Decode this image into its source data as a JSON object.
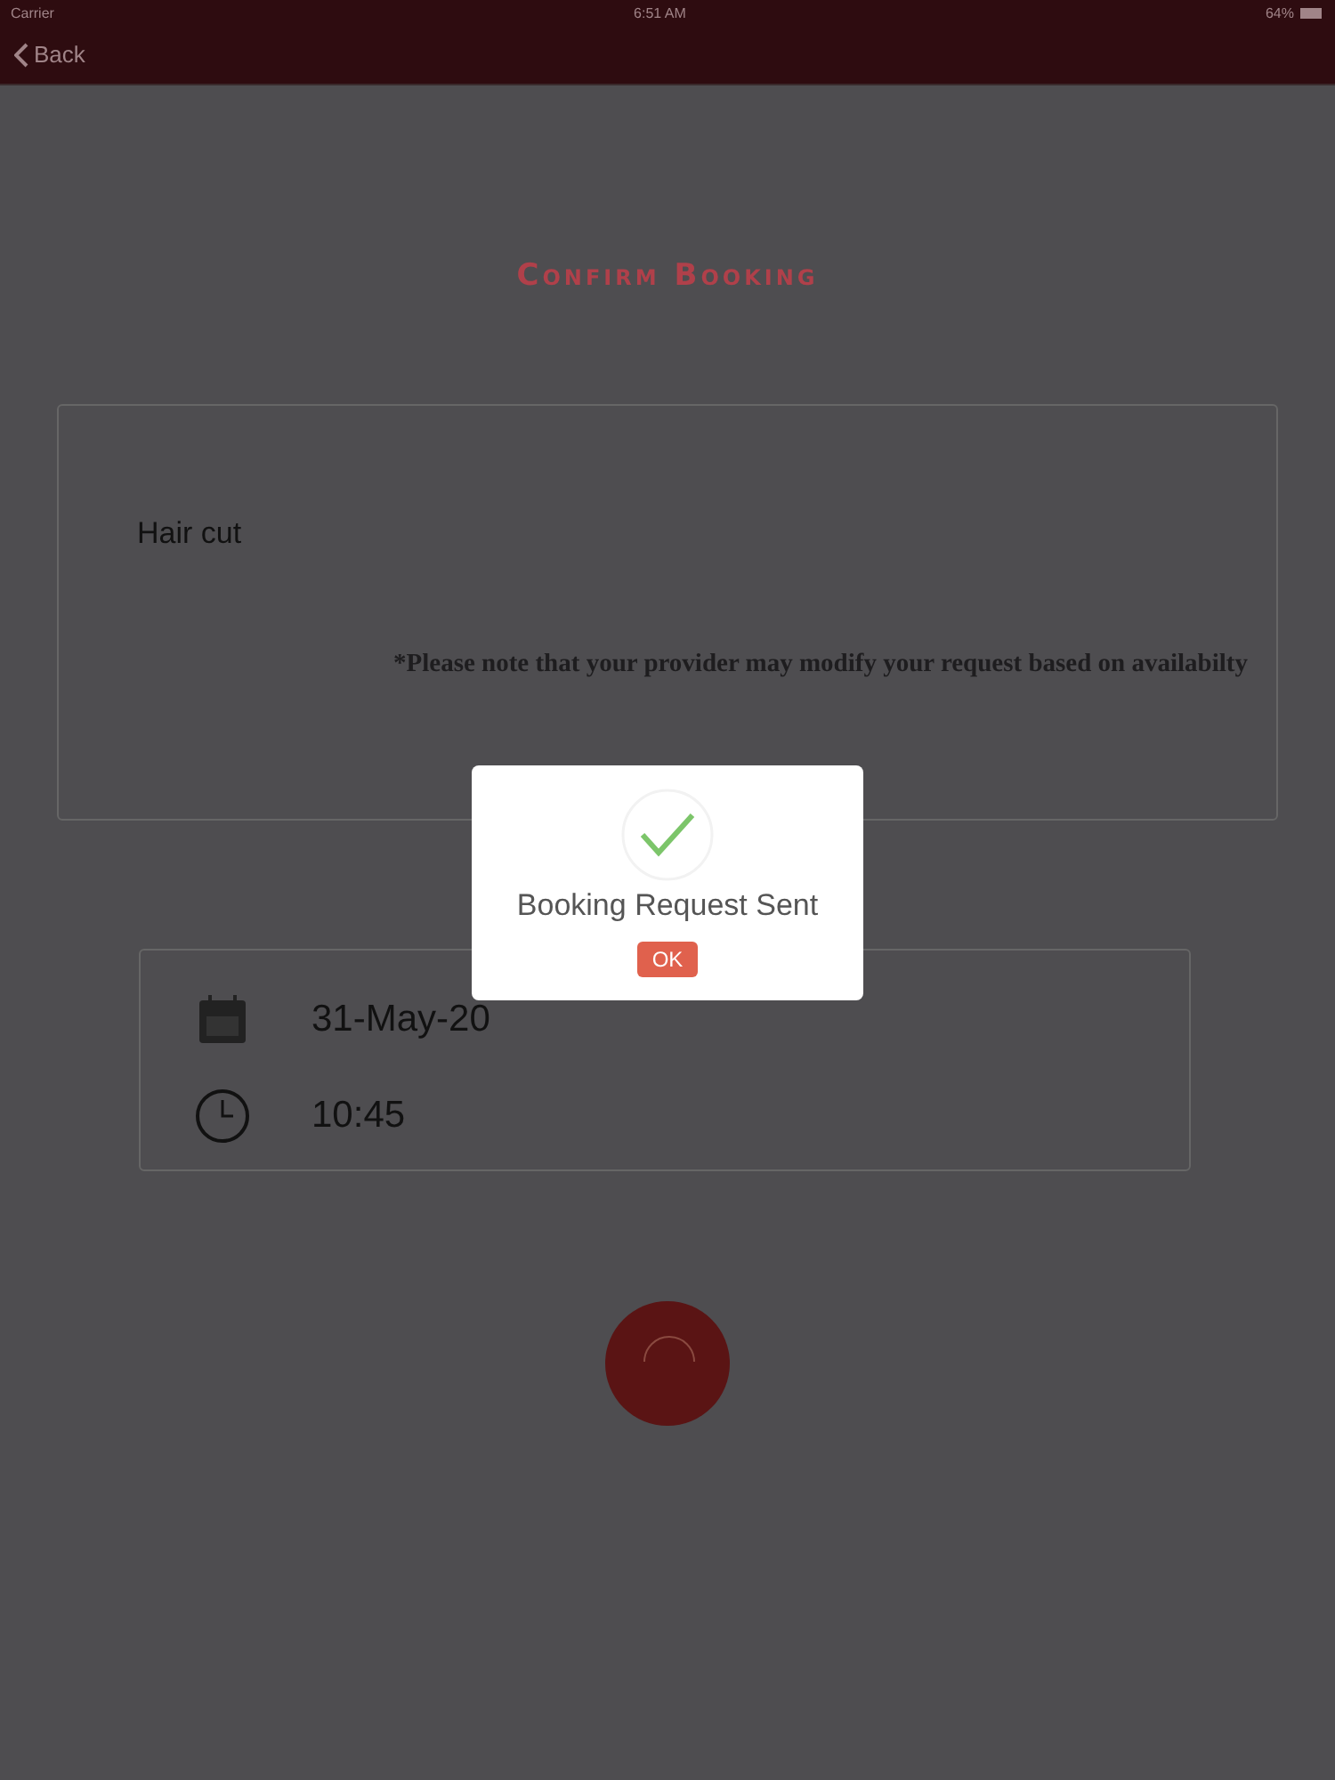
{
  "status_bar": {
    "carrier": "Carrier",
    "time": "6:51 AM",
    "battery": "64%"
  },
  "nav": {
    "back": "Back"
  },
  "title": "Confirm Booking",
  "service": {
    "name": "Hair cut",
    "note": "*Please note that your provider may modify your request based on availabilty"
  },
  "schedule": {
    "date": "31-May-20",
    "time": "10:45"
  },
  "dialog": {
    "message": "Booking Request Sent",
    "button": "OK"
  }
}
